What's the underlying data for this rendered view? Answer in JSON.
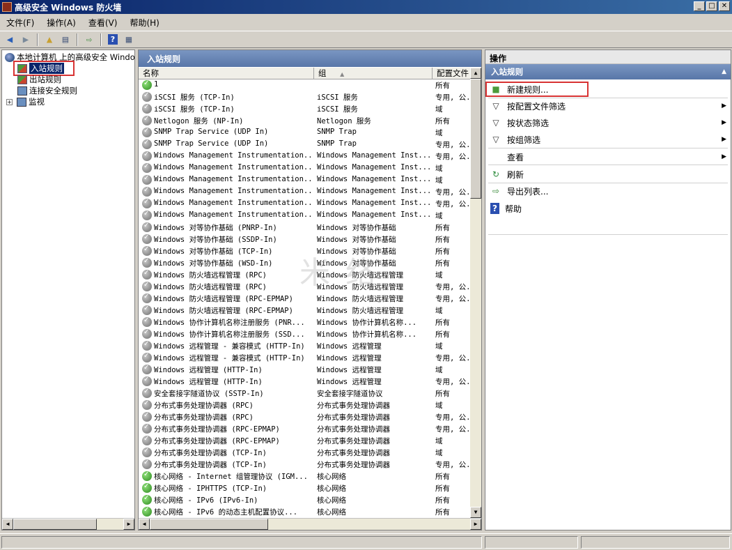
{
  "window": {
    "title": "高级安全 Windows 防火墙",
    "min": "_",
    "max": "□",
    "close": "✕"
  },
  "menu": [
    "文件(F)",
    "操作(A)",
    "查看(V)",
    "帮助(H)"
  ],
  "tree": {
    "root": "本地计算机 上的高级安全 Windows",
    "items": [
      "入站规则",
      "出站规则",
      "连接安全规则",
      "监视"
    ]
  },
  "center": {
    "header": "入站规则",
    "columns": [
      "名称",
      "组",
      "配置文件"
    ],
    "rows": [
      {
        "name": "1",
        "group": "",
        "profile": "所有",
        "enabled": true
      },
      {
        "name": "iSCSI 服务 (TCP-In)",
        "group": "iSCSI 服务",
        "profile": "专用, 公...",
        "enabled": false
      },
      {
        "name": "iSCSI 服务 (TCP-In)",
        "group": "iSCSI 服务",
        "profile": "域",
        "enabled": false
      },
      {
        "name": "Netlogon 服务 (NP-In)",
        "group": "Netlogon 服务",
        "profile": "所有",
        "enabled": false
      },
      {
        "name": "SNMP Trap Service (UDP In)",
        "group": "SNMP Trap",
        "profile": "域",
        "enabled": false
      },
      {
        "name": "SNMP Trap Service (UDP In)",
        "group": "SNMP Trap",
        "profile": "专用, 公...",
        "enabled": false
      },
      {
        "name": "Windows Management Instrumentation...",
        "group": "Windows Management Inst...",
        "profile": "专用, 公...",
        "enabled": false
      },
      {
        "name": "Windows Management Instrumentation...",
        "group": "Windows Management Inst...",
        "profile": "域",
        "enabled": false
      },
      {
        "name": "Windows Management Instrumentation...",
        "group": "Windows Management Inst...",
        "profile": "域",
        "enabled": false
      },
      {
        "name": "Windows Management Instrumentation...",
        "group": "Windows Management Inst...",
        "profile": "专用, 公...",
        "enabled": false
      },
      {
        "name": "Windows Management Instrumentation...",
        "group": "Windows Management Inst...",
        "profile": "专用, 公...",
        "enabled": false
      },
      {
        "name": "Windows Management Instrumentation...",
        "group": "Windows Management Inst...",
        "profile": "域",
        "enabled": false
      },
      {
        "name": "Windows 对等协作基础 (PNRP-In)",
        "group": "Windows 对等协作基础",
        "profile": "所有",
        "enabled": false
      },
      {
        "name": "Windows 对等协作基础 (SSDP-In)",
        "group": "Windows 对等协作基础",
        "profile": "所有",
        "enabled": false
      },
      {
        "name": "Windows 对等协作基础 (TCP-In)",
        "group": "Windows 对等协作基础",
        "profile": "所有",
        "enabled": false
      },
      {
        "name": "Windows 对等协作基础 (WSD-In)",
        "group": "Windows 对等协作基础",
        "profile": "所有",
        "enabled": false
      },
      {
        "name": "Windows 防火墙远程管理 (RPC)",
        "group": "Windows 防火墙远程管理",
        "profile": "域",
        "enabled": false
      },
      {
        "name": "Windows 防火墙远程管理 (RPC)",
        "group": "Windows 防火墙远程管理",
        "profile": "专用, 公...",
        "enabled": false
      },
      {
        "name": "Windows 防火墙远程管理 (RPC-EPMAP)",
        "group": "Windows 防火墙远程管理",
        "profile": "专用, 公...",
        "enabled": false
      },
      {
        "name": "Windows 防火墙远程管理 (RPC-EPMAP)",
        "group": "Windows 防火墙远程管理",
        "profile": "域",
        "enabled": false
      },
      {
        "name": "Windows 协作计算机名称注册服务 (PNR...",
        "group": "Windows 协作计算机名称...",
        "profile": "所有",
        "enabled": false
      },
      {
        "name": "Windows 协作计算机名称注册服务 (SSD...",
        "group": "Windows 协作计算机名称...",
        "profile": "所有",
        "enabled": false
      },
      {
        "name": "Windows 远程管理 - 兼容模式 (HTTP-In)",
        "group": "Windows 远程管理",
        "profile": "域",
        "enabled": false
      },
      {
        "name": "Windows 远程管理 - 兼容模式 (HTTP-In)",
        "group": "Windows 远程管理",
        "profile": "专用, 公...",
        "enabled": false
      },
      {
        "name": "Windows 远程管理 (HTTP-In)",
        "group": "Windows 远程管理",
        "profile": "域",
        "enabled": false
      },
      {
        "name": "Windows 远程管理 (HTTP-In)",
        "group": "Windows 远程管理",
        "profile": "专用, 公...",
        "enabled": false
      },
      {
        "name": "安全套接字隧道协议 (SSTP-In)",
        "group": "安全套接字隧道协议",
        "profile": "所有",
        "enabled": false
      },
      {
        "name": "分布式事务处理协调器 (RPC)",
        "group": "分布式事务处理协调器",
        "profile": "域",
        "enabled": false
      },
      {
        "name": "分布式事务处理协调器 (RPC)",
        "group": "分布式事务处理协调器",
        "profile": "专用, 公...",
        "enabled": false
      },
      {
        "name": "分布式事务处理协调器 (RPC-EPMAP)",
        "group": "分布式事务处理协调器",
        "profile": "专用, 公...",
        "enabled": false
      },
      {
        "name": "分布式事务处理协调器 (RPC-EPMAP)",
        "group": "分布式事务处理协调器",
        "profile": "域",
        "enabled": false
      },
      {
        "name": "分布式事务处理协调器 (TCP-In)",
        "group": "分布式事务处理协调器",
        "profile": "域",
        "enabled": false
      },
      {
        "name": "分布式事务处理协调器 (TCP-In)",
        "group": "分布式事务处理协调器",
        "profile": "专用, 公...",
        "enabled": false
      },
      {
        "name": "核心网络 - Internet 组管理协议 (IGM...",
        "group": "核心网络",
        "profile": "所有",
        "enabled": true
      },
      {
        "name": "核心网络 - IPHTTPS (TCP-In)",
        "group": "核心网络",
        "profile": "所有",
        "enabled": true
      },
      {
        "name": "核心网络 - IPv6 (IPv6-In)",
        "group": "核心网络",
        "profile": "所有",
        "enabled": true
      },
      {
        "name": "核心网络 - IPv6 的动态主机配置协议...",
        "group": "核心网络",
        "profile": "所有",
        "enabled": true
      }
    ]
  },
  "actions": {
    "header": "操作",
    "section": "入站规则",
    "items": [
      {
        "label": "新建规则...",
        "icon": "new-rule-icon",
        "submenu": false
      },
      {
        "label": "按配置文件筛选",
        "icon": "filter-icon",
        "submenu": true
      },
      {
        "label": "按状态筛选",
        "icon": "filter-icon",
        "submenu": true
      },
      {
        "label": "按组筛选",
        "icon": "filter-icon",
        "submenu": true
      },
      {
        "label": "查看",
        "icon": "",
        "submenu": true
      },
      {
        "label": "刷新",
        "icon": "refresh-icon",
        "submenu": false
      },
      {
        "label": "导出列表...",
        "icon": "export-icon",
        "submenu": false
      },
      {
        "label": "帮助",
        "icon": "help-icon",
        "submenu": false
      }
    ]
  },
  "watermark": "米 络"
}
